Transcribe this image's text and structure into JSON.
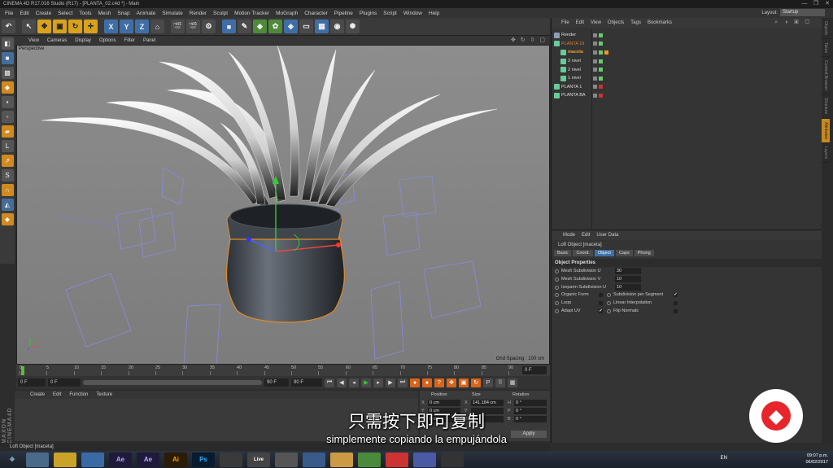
{
  "window": {
    "title": "CINEMA 4D R17.016 Studio (R17) - [PLANTA_02.c4d *] - Main",
    "controls": [
      "—",
      "❐",
      "✕"
    ]
  },
  "menubar": {
    "items": [
      "File",
      "Edit",
      "Create",
      "Select",
      "Tools",
      "Mesh",
      "Snap",
      "Animate",
      "Simulate",
      "Render",
      "Sculpt",
      "Motion Tracker",
      "MoGraph",
      "Character",
      "Pipeline",
      "Plugins",
      "Script",
      "Window",
      "Help"
    ],
    "layout_label": "Layout:",
    "layout_value": "Startup"
  },
  "viewport": {
    "menu": [
      "View",
      "Cameras",
      "Display",
      "Options",
      "Filter",
      "Panel"
    ],
    "label": "Perspective",
    "grid_spacing": "Grid Spacing : 100 cm"
  },
  "timeline": {
    "ticks": [
      "0",
      "5",
      "10",
      "15",
      "20",
      "25",
      "30",
      "35",
      "40",
      "45",
      "50",
      "55",
      "60",
      "65",
      "70",
      "75",
      "80",
      "85",
      "90"
    ],
    "end_frame": "0 F",
    "start_field": "0 F",
    "min_field": "0 F",
    "max_field": "90 F",
    "current_field": "90 F"
  },
  "material_manager": {
    "menu": [
      "Create",
      "Edit",
      "Function",
      "Texture"
    ]
  },
  "coordinates": {
    "headers": [
      "Position",
      "Size",
      "Rotation"
    ],
    "rows": [
      {
        "pos_axis": "X",
        "pos": "0 cm",
        "size_axis": "X",
        "size": "141.184 cm",
        "rot_axis": "H",
        "rot": "0 °"
      },
      {
        "pos_axis": "Y",
        "pos": "0 cm",
        "size_axis": "Y",
        "size": "",
        "rot_axis": "P",
        "rot": "0 °"
      },
      {
        "pos_axis": "Z",
        "pos": "0 cm",
        "size_axis": "Z",
        "size": "",
        "rot_axis": "B",
        "rot": "0 °"
      }
    ],
    "apply": "Apply"
  },
  "object_manager": {
    "menu": [
      "File",
      "Edit",
      "View",
      "Objects",
      "Tags",
      "Bookmarks"
    ],
    "objects": [
      {
        "name": "Render",
        "color": "#8a9fb5",
        "style": ""
      },
      {
        "name": "PLANTA 19",
        "color": "#6c9",
        "style": "orange"
      },
      {
        "name": "maceta",
        "color": "#6c9",
        "style": "sel"
      },
      {
        "name": "3 nivel",
        "color": "#6c9",
        "style": ""
      },
      {
        "name": "2 nivel",
        "color": "#6c9",
        "style": ""
      },
      {
        "name": "1 nivel",
        "color": "#6c9",
        "style": ""
      },
      {
        "name": "PLANTA 1",
        "color": "#6c9",
        "style": ""
      },
      {
        "name": "PLANTA BA",
        "color": "#6c9",
        "style": ""
      }
    ]
  },
  "attribute_manager": {
    "menu": [
      "Mode",
      "Edit",
      "User Data"
    ],
    "title": "Loft Object [maceta]",
    "tabs": [
      "Basic",
      "Coord.",
      "Object",
      "Caps",
      "Phong"
    ],
    "section": "Object Properties",
    "params": [
      {
        "name": "Mesh Subdivision U",
        "value": "30"
      },
      {
        "name": "Mesh Subdivision V",
        "value": "10"
      },
      {
        "name": "Isoparm Subdivision U",
        "value": "10"
      }
    ],
    "checks_left": [
      {
        "name": "Organic Form",
        "checked": ""
      },
      {
        "name": "Loop",
        "checked": ""
      },
      {
        "name": "Adapt UV",
        "checked": "✔"
      }
    ],
    "checks_right": [
      {
        "name": "Subdivision per Segment",
        "checked": "✔"
      },
      {
        "name": "Linear Interpolation",
        "checked": ""
      },
      {
        "name": "Flip Normals",
        "checked": ""
      }
    ]
  },
  "side_tabs": [
    "Objects",
    "Takes",
    "Content Browser",
    "Structure",
    "Attributes",
    "Layers"
  ],
  "status": "Loft Object [maceta]",
  "subtitles": {
    "zh": "只需按下即可复制",
    "es": "simplemente copiando la empujándola"
  },
  "taskbar": {
    "apps": [
      {
        "label": "",
        "color": "#4a6a8a"
      },
      {
        "label": "",
        "color": "#c9a227"
      },
      {
        "label": "",
        "color": "#3a6aa5"
      },
      {
        "label": "Ae",
        "color": "#1f1a3a"
      },
      {
        "label": "Ae",
        "color": "#1f1a3a"
      },
      {
        "label": "Ai",
        "color": "#2a1c06"
      },
      {
        "label": "Ps",
        "color": "#081c2f"
      },
      {
        "label": "",
        "color": "#3a3a3a"
      },
      {
        "label": "Live",
        "color": "#444"
      },
      {
        "label": "",
        "color": "#555"
      },
      {
        "label": "",
        "color": "#3a5a8a"
      },
      {
        "label": "",
        "color": "#c94"
      },
      {
        "label": "",
        "color": "#4a8a3a"
      },
      {
        "label": "",
        "color": "#c33"
      },
      {
        "label": "",
        "color": "#4a5aa5"
      },
      {
        "label": "",
        "color": "#333"
      }
    ],
    "lang": "EN",
    "time": "09:07 p.m.",
    "date": "06/02/2017"
  }
}
